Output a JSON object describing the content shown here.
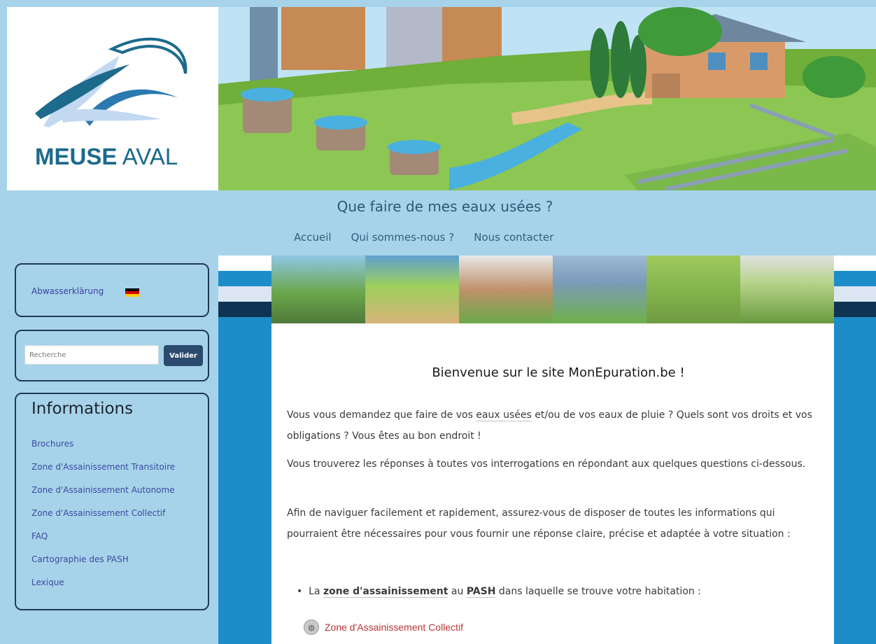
{
  "header": {
    "logo_text_bold": "MEUSE",
    "logo_text_light": "AVAL",
    "site_title": "Que faire de mes eaux usées ?"
  },
  "nav": {
    "items": [
      "Accueil",
      "Qui sommes-nous ?",
      "Nous contacter"
    ]
  },
  "sidebar": {
    "lang_link": "Abwasserklärung",
    "search_placeholder": "Recherche",
    "search_button": "Valider",
    "info_title": "Informations",
    "info_items": [
      "Brochures",
      "Zone d'Assainissement Transitoire",
      "Zone d'Assainissement Autonome",
      "Zone d'Assainissement Collectif",
      "FAQ",
      "Cartographie des PASH",
      "Lexique"
    ]
  },
  "content": {
    "welcome": "Bienvenue sur le site MonEpuration.be !",
    "p1_a": "Vous vous demandez que faire de vos ",
    "p1_link": "eaux usées",
    "p1_b": " et/ou de vos eaux de pluie ? Quels sont vos droits et vos obligations ? Vous êtes au bon endroit !",
    "p2": "Vous trouverez les réponses à toutes vos interrogations en répondant aux quelques questions ci-dessous.",
    "p3": "Afin de naviguer facilement et rapidement, assurez-vous de disposer de toutes les informations qui pourraient être nécessaires pour vous fournir une réponse claire, précise et adaptée à votre situation :",
    "bullet_a": "La ",
    "bullet_link1": "zone d'assainissement",
    "bullet_mid": " au ",
    "bullet_link2": "PASH",
    "bullet_b": " dans laquelle se trouve votre habitation :",
    "zone_option": "Zone d'Assainissement Collectif"
  },
  "colors": {
    "page_bg": "#a7d3ea",
    "content_blue": "#1d8dca",
    "dark_navy": "#1f3a56",
    "button": "#2b4a6e",
    "link": "#3a4aa0",
    "zone_link": "#b83535"
  }
}
